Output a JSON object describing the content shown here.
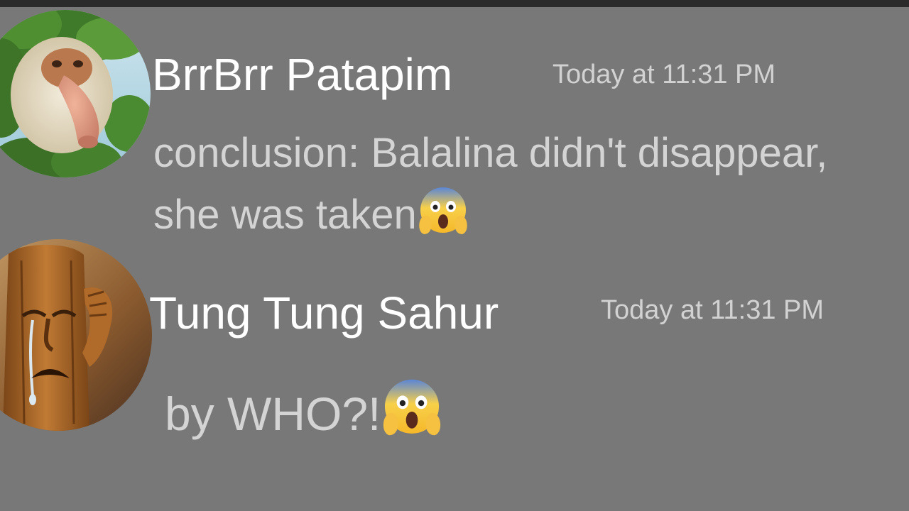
{
  "messages": [
    {
      "username": "BrrBrr Patapim",
      "timestamp": "Today at 11:31 PM",
      "lines": [
        "conclusion: Balalina didn't disappear,",
        "she was taken"
      ],
      "emoji": "face-screaming-in-fear-icon"
    },
    {
      "username": "Tung Tung Sahur",
      "timestamp": "Today at 11:31 PM",
      "lines": [
        "by WHO?!"
      ],
      "emoji": "face-screaming-in-fear-icon"
    }
  ],
  "colors": {
    "background": "#787878",
    "username": "#ffffff",
    "timestamp": "#d2d2d2",
    "message_text": "#d4d4d4"
  }
}
